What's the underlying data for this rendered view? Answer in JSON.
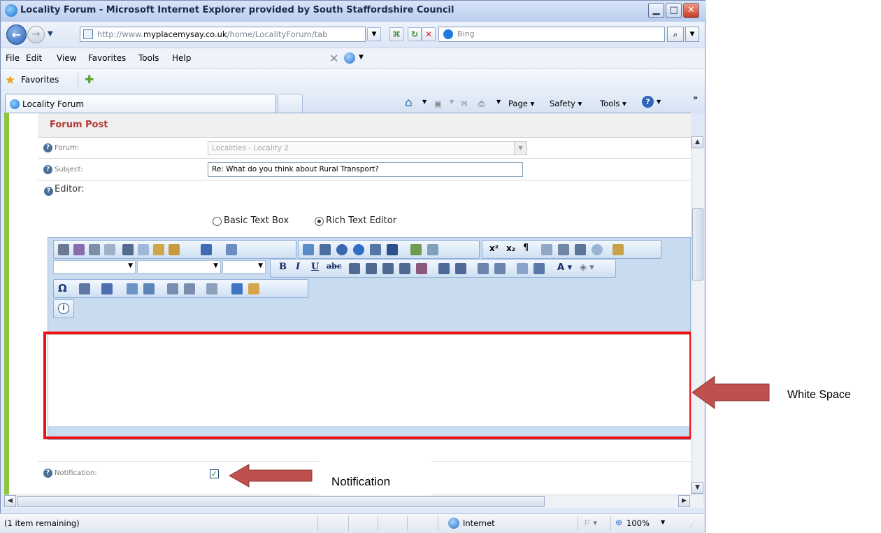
{
  "window": {
    "title": "Locality Forum - Microsoft Internet Explorer provided by South Staffordshire Council"
  },
  "address": {
    "url_prefix": "http://www.",
    "url_domain": "myplacemysay.co.uk",
    "url_path": "/home/LocalityForum/tab",
    "search_placeholder": "Bing"
  },
  "menu": [
    "File",
    "Edit",
    "View",
    "Favorites",
    "Tools",
    "Help"
  ],
  "favorites": {
    "label": "Favorites"
  },
  "tab": {
    "label": "Locality Forum"
  },
  "command_bar": {
    "page": "Page",
    "safety": "Safety",
    "tools": "Tools"
  },
  "form": {
    "header": "Forum Post",
    "forum_label": "Forum:",
    "forum_value": "Localities - Locality 2",
    "subject_label": "Subject:",
    "subject_value": "Re: What do you think about Rural Transport?",
    "editor_label": "Editor:",
    "editor_options": [
      "Basic Text Box",
      "Rich Text Editor"
    ],
    "editor_selected": "Rich Text Editor",
    "notification_label": "Notification:",
    "notification_checked": true
  },
  "status_bar": {
    "text": "(1 item remaining)",
    "zone": "Internet",
    "zoom": "100%"
  },
  "annotations": {
    "white_space": "White Space",
    "notification": "Notification",
    "highlight_color": "#ee1111",
    "arrow_color": "#c0504d"
  },
  "colors": {
    "accent_green": "#8cc63f",
    "header_red": "#b23b32"
  }
}
